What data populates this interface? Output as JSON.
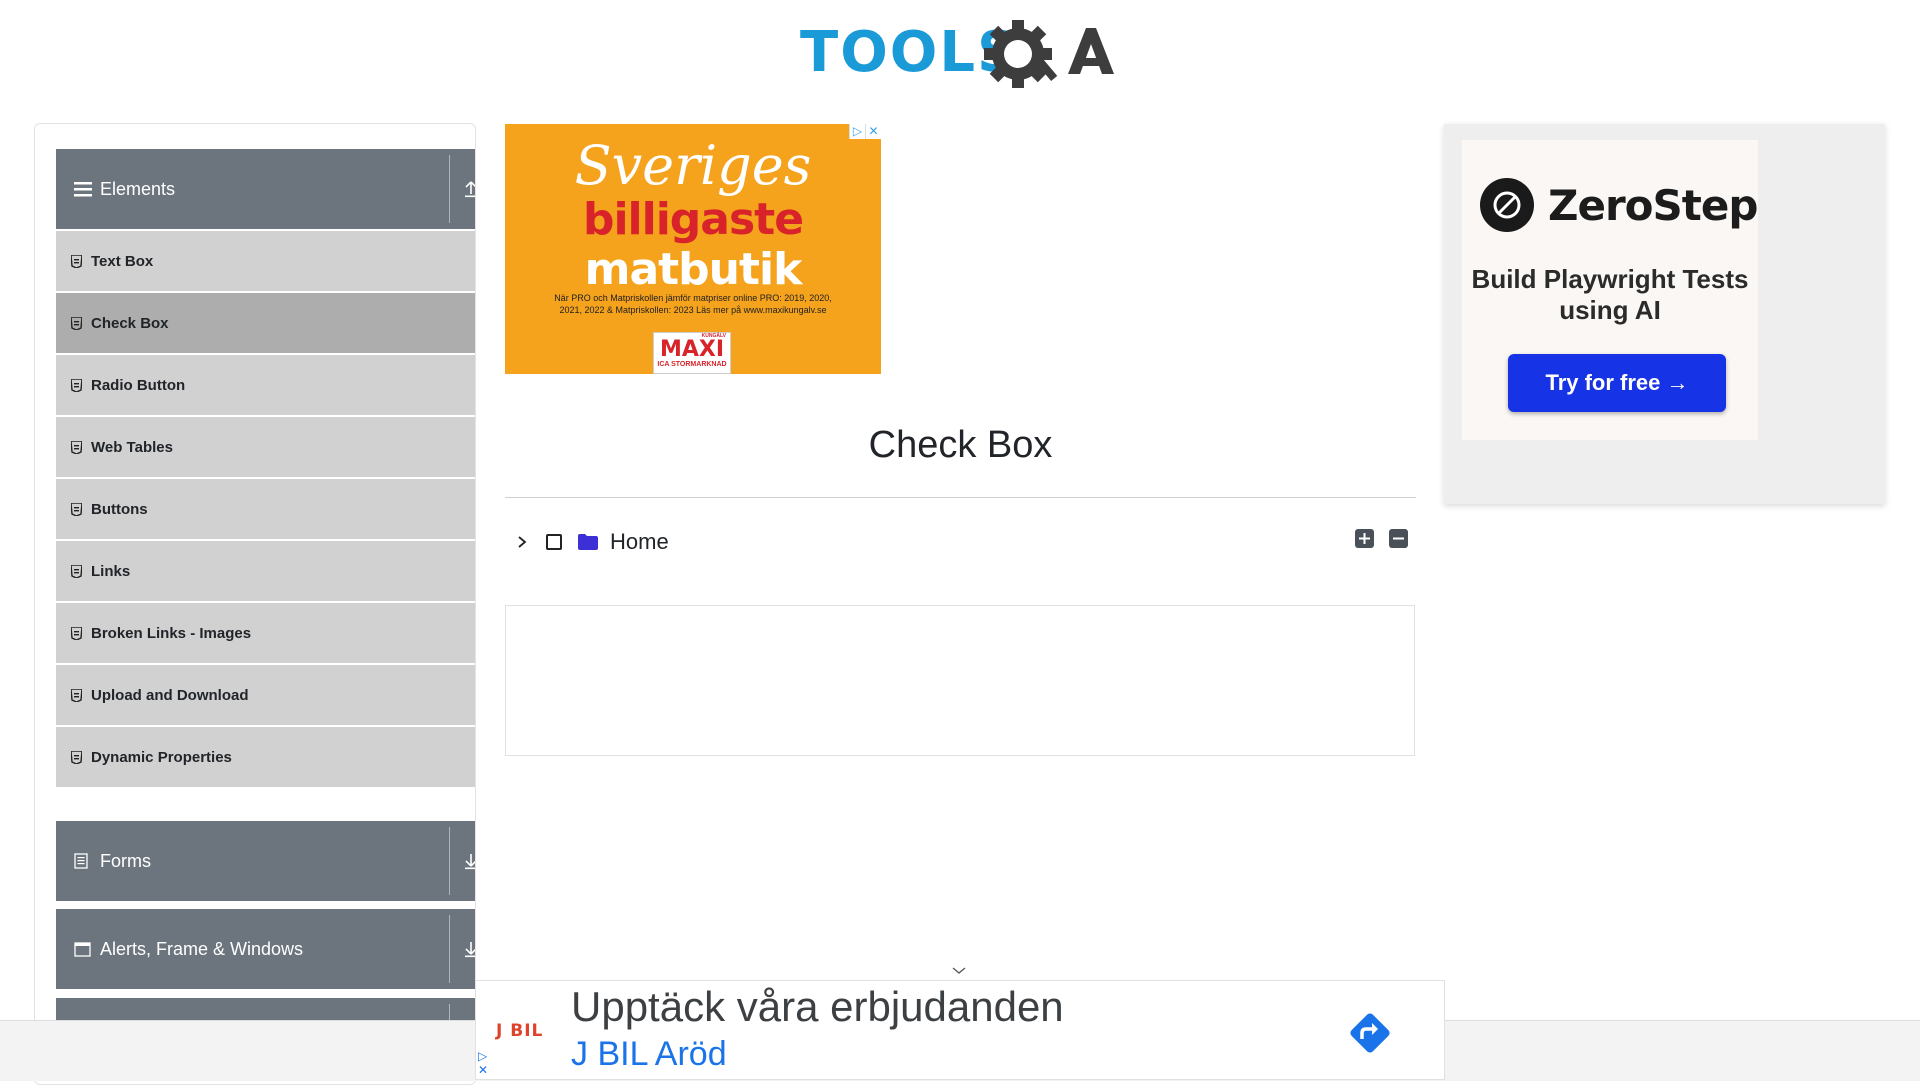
{
  "header": {
    "logo_text": "TOOLS",
    "logo_suffix": "QA"
  },
  "sidebar": {
    "groups": [
      {
        "label": "Elements",
        "icon": "hamburger-icon",
        "toggle_icon": "upload-arrow-icon",
        "expanded": true
      },
      {
        "label": "Forms",
        "icon": "document-icon",
        "toggle_icon": "download-arrow-icon",
        "expanded": false
      },
      {
        "label": "Alerts, Frame & Windows",
        "icon": "window-icon",
        "toggle_icon": "download-arrow-icon",
        "expanded": false
      }
    ],
    "items": [
      {
        "label": "Text Box",
        "active": false
      },
      {
        "label": "Check Box",
        "active": true
      },
      {
        "label": "Radio Button",
        "active": false
      },
      {
        "label": "Web Tables",
        "active": false
      },
      {
        "label": "Buttons",
        "active": false
      },
      {
        "label": "Links",
        "active": false
      },
      {
        "label": "Broken Links - Images",
        "active": false
      },
      {
        "label": "Upload and Download",
        "active": false
      },
      {
        "label": "Dynamic Properties",
        "active": false
      }
    ]
  },
  "ad_top": {
    "line1": "Sveriges",
    "line2": "billigaste",
    "line3": "matbutik",
    "small_text": "När PRO och Matpriskollen jämför matpriser online PRO: 2019, 2020, 2021, 2022 & Matpriskollen: 2023 Läs mer på www.maxikungalv.se",
    "maxi_top": "KUNGÄLV",
    "maxi_brand": "MAXI",
    "maxi_sub": "ICA STORMARKNAD"
  },
  "main": {
    "title": "Check Box",
    "tree_node": {
      "label": "Home",
      "checked": false,
      "expanded": false
    },
    "expand_all_icon": "plus-square-icon",
    "collapse_all_icon": "minus-square-icon"
  },
  "ad_right": {
    "brand": "ZeroStep",
    "tagline": "Build Playwright Tests using AI",
    "cta": "Try for free →"
  },
  "ad_bottom": {
    "brand": "J BIL",
    "headline": "Upptäck våra erbjudanden",
    "subline": "J BIL Aröd"
  },
  "colors": {
    "logo_blue": "#1a9ad6",
    "logo_dark": "#3d3d3d",
    "sidebar_header": "#6c757d",
    "menu_item": "#d1d1d1",
    "menu_active": "#adadad",
    "folder": "#3d2fd6",
    "cta_blue": "#1733e6",
    "ad_orange": "#f5a21c"
  }
}
